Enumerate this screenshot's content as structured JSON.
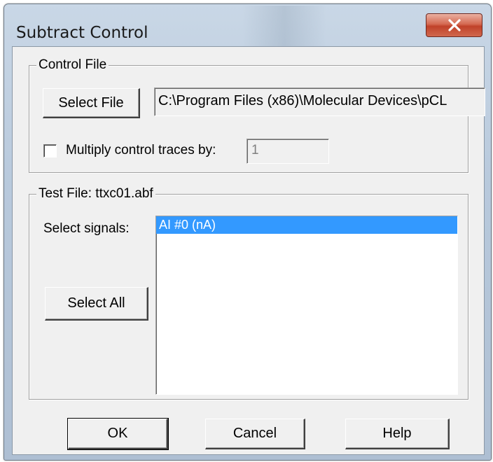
{
  "window": {
    "title": "Subtract Control",
    "close_icon": "close-icon"
  },
  "control_file": {
    "legend": "Control File",
    "select_file_label": "Select File",
    "path_value": "C:\\Program Files (x86)\\Molecular Devices\\pCL",
    "multiply_label": "Multiply control traces by:",
    "multiply_checked": false,
    "multiply_value": "1"
  },
  "test_file": {
    "legend": "Test File: ttxc01.abf",
    "select_signals_label": "Select signals:",
    "select_all_label": "Select All",
    "signals": [
      {
        "label": "AI #0 (nA)",
        "selected": true
      }
    ]
  },
  "buttons": {
    "ok": "OK",
    "cancel": "Cancel",
    "help": "Help"
  },
  "colors": {
    "selection": "#3399ff",
    "close_button": "#c0422a",
    "dialog_face": "#f0f0f0"
  }
}
